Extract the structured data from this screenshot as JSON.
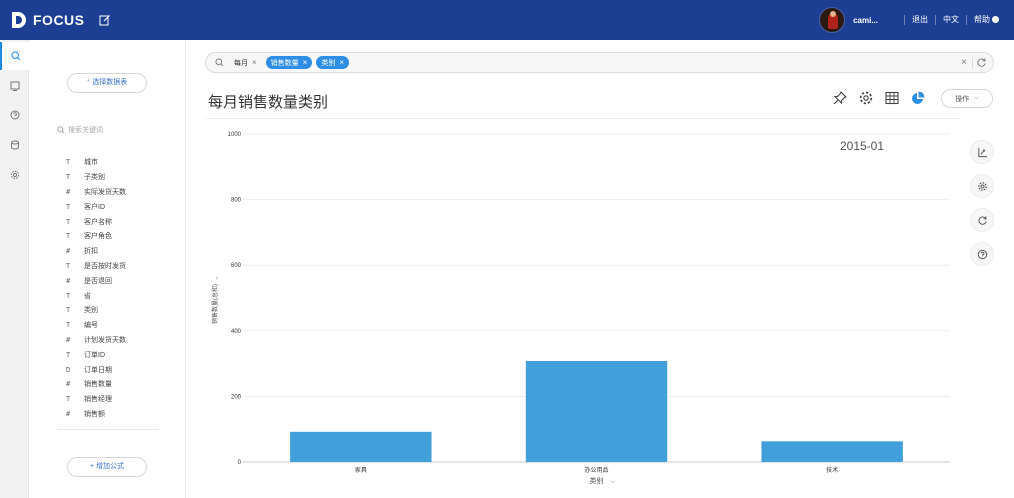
{
  "topbar": {
    "brand": "FOCUS",
    "username": "cami...",
    "links": [
      "退出",
      "中文",
      "帮助"
    ],
    "colors": {
      "bar": "#1c3f94"
    }
  },
  "rail": {
    "icons": [
      "search-icon",
      "dashboard-icon",
      "question-icon",
      "database-icon",
      "gear-icon"
    ],
    "active": "search-icon"
  },
  "panel": {
    "select_source_label": "⁺ 选择数据表",
    "search_placeholder": "搜索关键词",
    "columns": [
      {
        "type": "T",
        "label": "城市"
      },
      {
        "type": "T",
        "label": "子类别"
      },
      {
        "type": "#",
        "label": "实际发货天数"
      },
      {
        "type": "T",
        "label": "客户ID"
      },
      {
        "type": "T",
        "label": "客户名称"
      },
      {
        "type": "T",
        "label": "客户角色"
      },
      {
        "type": "#",
        "label": "折扣"
      },
      {
        "type": "T",
        "label": "是否按时发货"
      },
      {
        "type": "#",
        "label": "是否退回"
      },
      {
        "type": "T",
        "label": "省"
      },
      {
        "type": "T",
        "label": "类别"
      },
      {
        "type": "T",
        "label": "编号"
      },
      {
        "type": "#",
        "label": "计划发货天数"
      },
      {
        "type": "T",
        "label": "订单ID"
      },
      {
        "type": "D",
        "label": "订单日期"
      },
      {
        "type": "#",
        "label": "销售数量"
      },
      {
        "type": "T",
        "label": "销售经理"
      },
      {
        "type": "#",
        "label": "销售额"
      }
    ],
    "add_formula_label": "+ 增加公式"
  },
  "search": {
    "tokens": [
      {
        "label": "每月",
        "style": "plain"
      },
      {
        "label": "销售数量",
        "style": "blue"
      },
      {
        "label": "类别",
        "style": "blue"
      }
    ]
  },
  "main": {
    "title": "每月销售数量类别",
    "operate_label": "操作",
    "toolbar_icons": [
      "pin-icon",
      "gear-icon",
      "table-icon",
      "pie-chart-icon"
    ],
    "side_tools": [
      "axis-icon",
      "gear-icon",
      "refresh-icon",
      "help-icon"
    ]
  },
  "chart_data": {
    "type": "bar",
    "period_label": "2015-01",
    "categories": [
      "家具",
      "办公用品",
      "技术"
    ],
    "values": [
      92,
      308,
      63
    ],
    "xlabel": "类别",
    "ylabel": "销售数量(总和)",
    "ylim": [
      0,
      1000
    ],
    "yticks": [
      0,
      200,
      400,
      600,
      800,
      1000
    ],
    "bar_color": "#419fd9",
    "grid": true
  }
}
